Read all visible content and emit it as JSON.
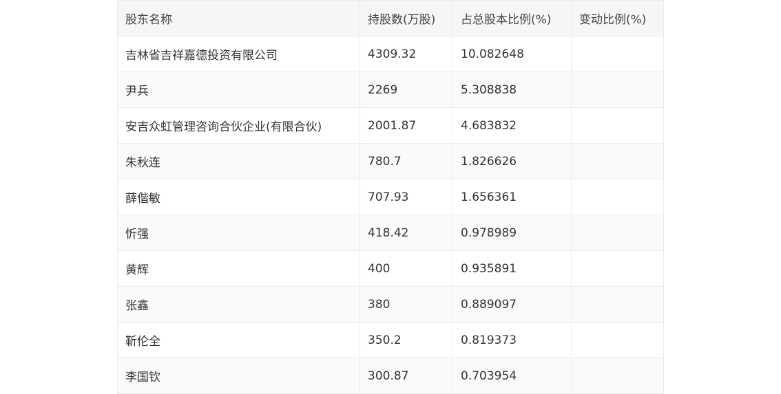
{
  "table": {
    "headers": [
      "股东名称",
      "持股数(万股)",
      "占总股本比例(%)",
      "变动比例(%)"
    ],
    "rows": [
      [
        "吉林省吉祥嘉德投资有限公司",
        "4309.32",
        "10.082648",
        ""
      ],
      [
        "尹兵",
        "2269",
        "5.308838",
        ""
      ],
      [
        "安吉众虹管理咨询合伙企业(有限合伙)",
        "2001.87",
        "4.683832",
        ""
      ],
      [
        "朱秋连",
        "780.7",
        "1.826626",
        ""
      ],
      [
        "薛偕敏",
        "707.93",
        "1.656361",
        ""
      ],
      [
        "忻强",
        "418.42",
        "0.978989",
        ""
      ],
      [
        "黄辉",
        "400",
        "0.935891",
        ""
      ],
      [
        "张鑫",
        "380",
        "0.889097",
        ""
      ],
      [
        "靳伦全",
        "350.2",
        "0.819373",
        ""
      ],
      [
        "李国钦",
        "300.87",
        "0.703954",
        ""
      ]
    ]
  }
}
